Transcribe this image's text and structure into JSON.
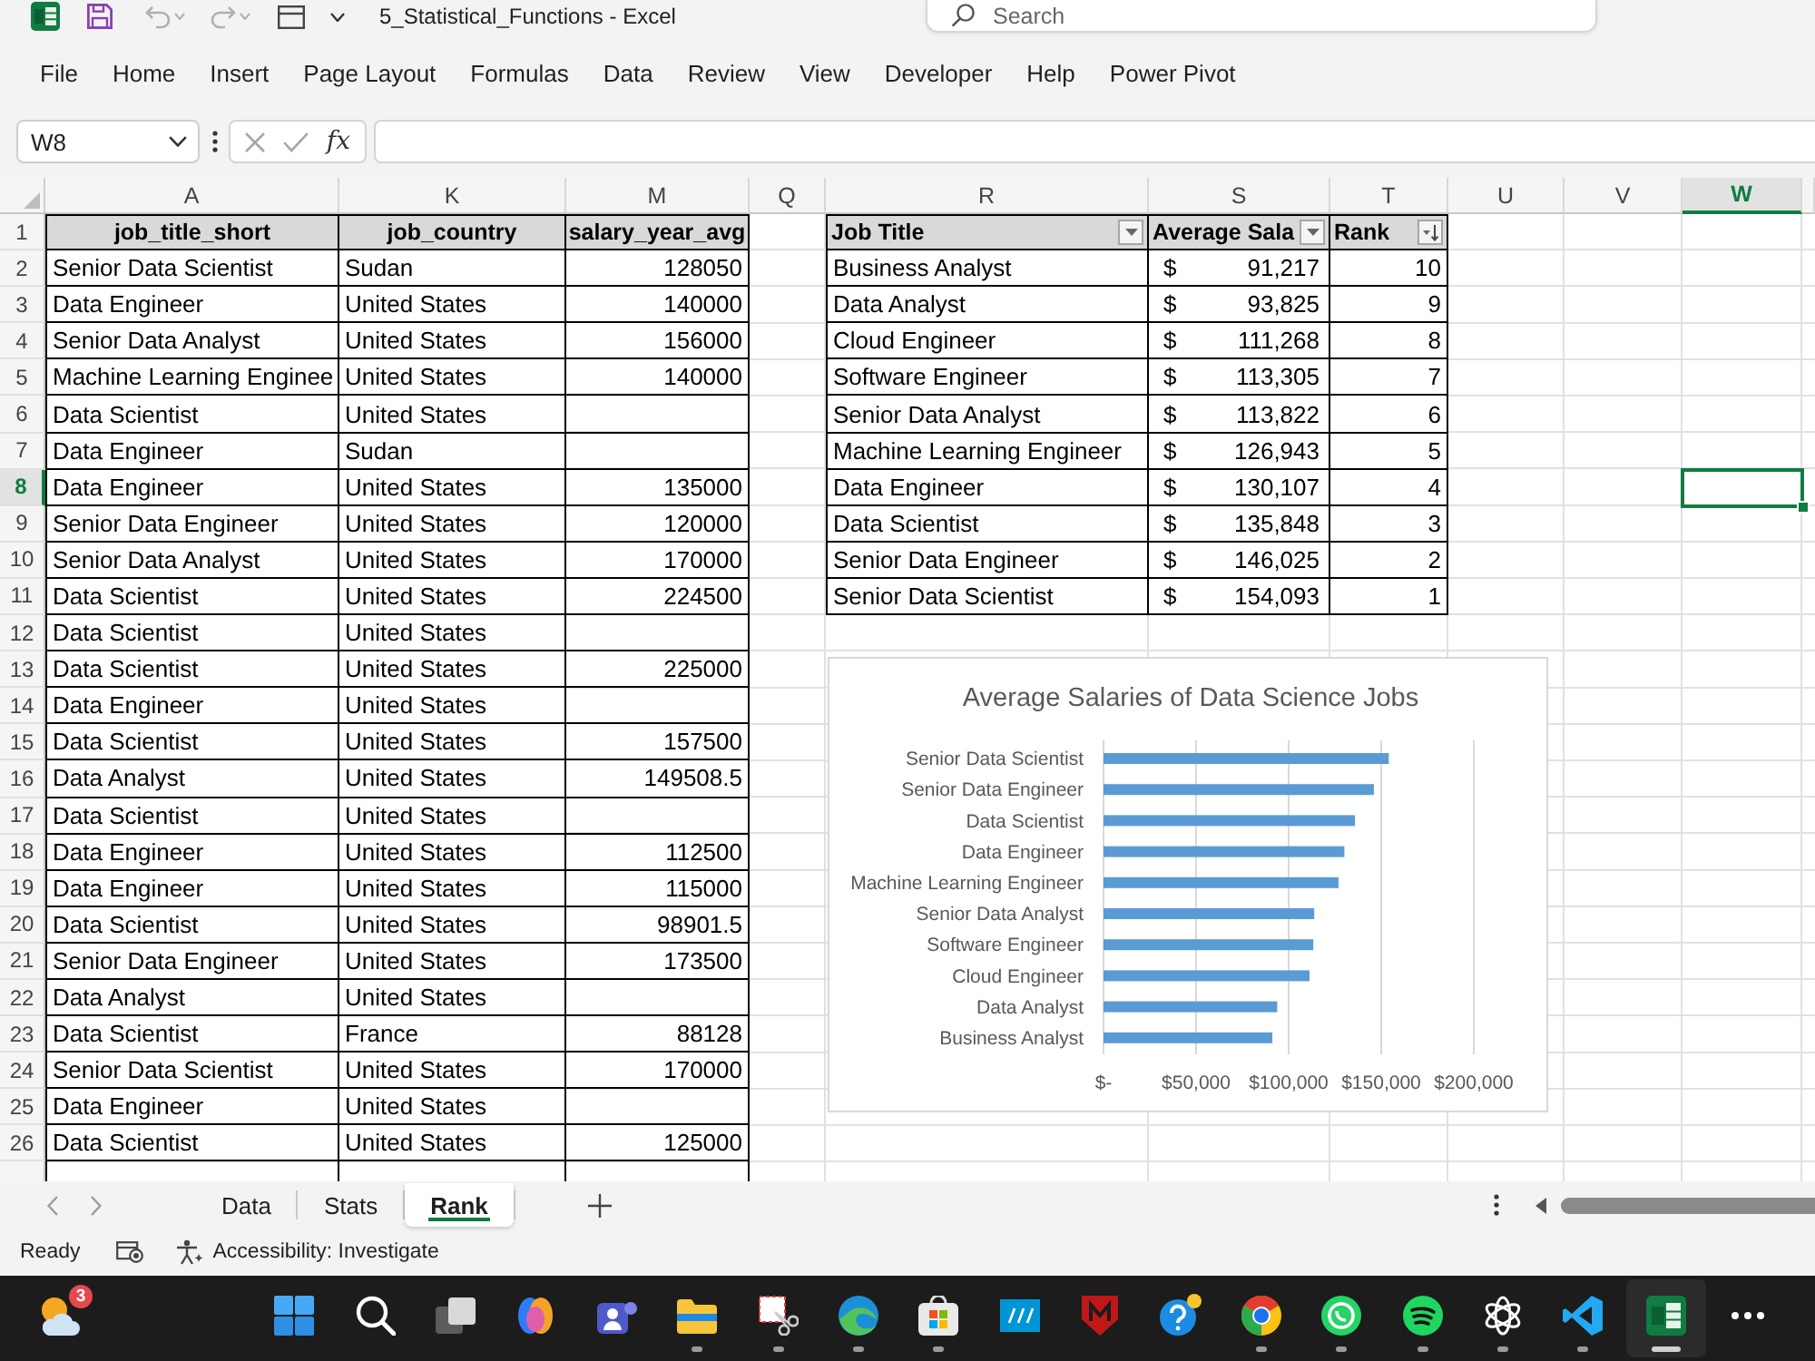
{
  "title_bar": {
    "document_title": "5_Statistical_Functions - Excel",
    "search": {
      "placeholder": "Search"
    }
  },
  "menu_tabs": [
    "File",
    "Home",
    "Insert",
    "Page Layout",
    "Formulas",
    "Data",
    "Review",
    "View",
    "Developer",
    "Help",
    "Power Pivot"
  ],
  "formula_bar": {
    "name_box": "W8",
    "function_button": "fx"
  },
  "sheet": {
    "columns": [
      {
        "label": "A",
        "selected": false
      },
      {
        "label": "K",
        "selected": false
      },
      {
        "label": "M",
        "selected": false
      },
      {
        "label": "Q",
        "selected": false
      },
      {
        "label": "R",
        "selected": false
      },
      {
        "label": "S",
        "selected": false
      },
      {
        "label": "T",
        "selected": false
      },
      {
        "label": "U",
        "selected": false
      },
      {
        "label": "V",
        "selected": false
      },
      {
        "label": "W",
        "selected": true
      }
    ],
    "rows": [
      {
        "number": "1",
        "selected": false
      },
      {
        "number": "2",
        "selected": false
      },
      {
        "number": "3",
        "selected": false
      },
      {
        "number": "4",
        "selected": false
      },
      {
        "number": "5",
        "selected": false
      },
      {
        "number": "6",
        "selected": false
      },
      {
        "number": "7",
        "selected": false
      },
      {
        "number": "8",
        "selected": true
      },
      {
        "number": "9",
        "selected": false
      },
      {
        "number": "10",
        "selected": false
      },
      {
        "number": "11",
        "selected": false
      },
      {
        "number": "12",
        "selected": false
      },
      {
        "number": "13",
        "selected": false
      },
      {
        "number": "14",
        "selected": false
      },
      {
        "number": "15",
        "selected": false
      },
      {
        "number": "16",
        "selected": false
      },
      {
        "number": "17",
        "selected": false
      },
      {
        "number": "18",
        "selected": false
      },
      {
        "number": "19",
        "selected": false
      },
      {
        "number": "20",
        "selected": false
      },
      {
        "number": "21",
        "selected": false
      },
      {
        "number": "22",
        "selected": false
      },
      {
        "number": "23",
        "selected": false
      },
      {
        "number": "24",
        "selected": false
      },
      {
        "number": "25",
        "selected": false
      },
      {
        "number": "26",
        "selected": false
      }
    ],
    "data_table": {
      "columns": [
        "job_title_short",
        "job_country",
        "salary_year_avg"
      ],
      "rows": [
        {
          "job_title_short": "Senior Data Scientist",
          "job_country": "Sudan",
          "salary_year_avg": "128050"
        },
        {
          "job_title_short": "Data Engineer",
          "job_country": "United States",
          "salary_year_avg": "140000"
        },
        {
          "job_title_short": "Senior Data Analyst",
          "job_country": "United States",
          "salary_year_avg": "156000"
        },
        {
          "job_title_short": "Machine Learning Enginee",
          "job_country": "United States",
          "salary_year_avg": "140000"
        },
        {
          "job_title_short": "Data Scientist",
          "job_country": "United States"
        },
        {
          "job_title_short": "Data Engineer",
          "job_country": "Sudan"
        },
        {
          "job_title_short": "Data Engineer",
          "job_country": "United States",
          "salary_year_avg": "135000"
        },
        {
          "job_title_short": "Senior Data Engineer",
          "job_country": "United States",
          "salary_year_avg": "120000"
        },
        {
          "job_title_short": "Senior Data Analyst",
          "job_country": "United States",
          "salary_year_avg": "170000"
        },
        {
          "job_title_short": "Data Scientist",
          "job_country": "United States",
          "salary_year_avg": "224500"
        },
        {
          "job_title_short": "Data Scientist",
          "job_country": "United States"
        },
        {
          "job_title_short": "Data Scientist",
          "job_country": "United States",
          "salary_year_avg": "225000"
        },
        {
          "job_title_short": "Data Engineer",
          "job_country": "United States"
        },
        {
          "job_title_short": "Data Scientist",
          "job_country": "United States",
          "salary_year_avg": "157500"
        },
        {
          "job_title_short": "Data Analyst",
          "job_country": "United States",
          "salary_year_avg": "149508.5"
        },
        {
          "job_title_short": "Data Scientist",
          "job_country": "United States"
        },
        {
          "job_title_short": "Data Engineer",
          "job_country": "United States",
          "salary_year_avg": "112500"
        },
        {
          "job_title_short": "Data Engineer",
          "job_country": "United States",
          "salary_year_avg": "115000"
        },
        {
          "job_title_short": "Data Scientist",
          "job_country": "United States",
          "salary_year_avg": "98901.5"
        },
        {
          "job_title_short": "Senior Data Engineer",
          "job_country": "United States",
          "salary_year_avg": "173500"
        },
        {
          "job_title_short": "Data Analyst",
          "job_country": "United States"
        },
        {
          "job_title_short": "Data Scientist",
          "job_country": "France",
          "salary_year_avg": "88128"
        },
        {
          "job_title_short": "Senior Data Scientist",
          "job_country": "United States",
          "salary_year_avg": "170000"
        },
        {
          "job_title_short": "Data Engineer",
          "job_country": "United States"
        },
        {
          "job_title_short": "Data Scientist",
          "job_country": "United States",
          "salary_year_avg": "125000"
        }
      ]
    },
    "rank_table": {
      "columns": [
        {
          "label": "Job Title",
          "kind": "filter"
        },
        {
          "label": "Average Sala",
          "kind": "filter"
        },
        {
          "label": "Rank",
          "kind": "sort_descending"
        }
      ],
      "rows": [
        {
          "job_title": "Business Analyst",
          "currency": "$",
          "average_salary": "91,217",
          "rank": "10"
        },
        {
          "job_title": "Data Analyst",
          "currency": "$",
          "average_salary": "93,825",
          "rank": "9"
        },
        {
          "job_title": "Cloud Engineer",
          "currency": "$",
          "average_salary": "111,268",
          "rank": "8"
        },
        {
          "job_title": "Software Engineer",
          "currency": "$",
          "average_salary": "113,305",
          "rank": "7"
        },
        {
          "job_title": "Senior Data Analyst",
          "currency": "$",
          "average_salary": "113,822",
          "rank": "6"
        },
        {
          "job_title": "Machine Learning Engineer",
          "currency": "$",
          "average_salary": "126,943",
          "rank": "5"
        },
        {
          "job_title": "Data Engineer",
          "currency": "$",
          "average_salary": "130,107",
          "rank": "4"
        },
        {
          "job_title": "Data Scientist",
          "currency": "$",
          "average_salary": "135,848",
          "rank": "3"
        },
        {
          "job_title": "Senior Data Engineer",
          "currency": "$",
          "average_salary": "146,025",
          "rank": "2"
        },
        {
          "job_title": "Senior Data Scientist",
          "currency": "$",
          "average_salary": "154,093",
          "rank": "1"
        }
      ]
    },
    "chart": {
      "chart_data": {
        "type": "bar",
        "orientation": "horizontal",
        "title": "Average Salaries of Data Science Jobs",
        "categories": [
          "Senior Data Scientist",
          "Senior Data Engineer",
          "Data Scientist",
          "Data Engineer",
          "Machine Learning Engineer",
          "Senior Data Analyst",
          "Software Engineer",
          "Cloud Engineer",
          "Data Analyst",
          "Business Analyst"
        ],
        "values": [
          154093,
          146025,
          135848,
          130107,
          126943,
          113822,
          113305,
          111268,
          93825,
          91217
        ],
        "xlim": [
          0,
          200000
        ],
        "xticks": [
          {
            "value": 0,
            "label": "$-"
          },
          {
            "value": 50000,
            "label": "$50,000"
          },
          {
            "value": 100000,
            "label": "$100,000"
          },
          {
            "value": 150000,
            "label": "$150,000"
          },
          {
            "value": 200000,
            "label": "$200,000"
          }
        ],
        "grid": true
      }
    }
  },
  "sheet_tabs": [
    {
      "label": "Data",
      "selected": false
    },
    {
      "label": "Stats",
      "selected": false
    },
    {
      "label": "Rank",
      "selected": true
    }
  ],
  "status_bar": {
    "mode": "Ready",
    "accessibility": "Accessibility: Investigate"
  },
  "taskbar": {
    "weather_badge": "3",
    "apps": [
      {
        "running": false,
        "active": false
      },
      {
        "running": false,
        "active": false
      },
      {
        "running": false,
        "active": false
      },
      {
        "running": false,
        "active": false
      },
      {
        "running": false,
        "active": false
      },
      {
        "running": false,
        "active": false
      },
      {
        "running": true,
        "active": false
      },
      {
        "running": true,
        "active": false
      },
      {
        "running": true,
        "active": false
      },
      {
        "running": true,
        "active": false
      },
      {
        "running": false,
        "active": false
      },
      {
        "running": false,
        "active": false
      },
      {
        "running": false,
        "active": false
      },
      {
        "running": true,
        "active": false
      },
      {
        "running": true,
        "active": false
      },
      {
        "running": true,
        "active": false
      },
      {
        "running": true,
        "active": false
      },
      {
        "running": true,
        "active": false
      },
      {
        "running": true,
        "active": true
      },
      {
        "running": false,
        "active": false
      }
    ]
  }
}
